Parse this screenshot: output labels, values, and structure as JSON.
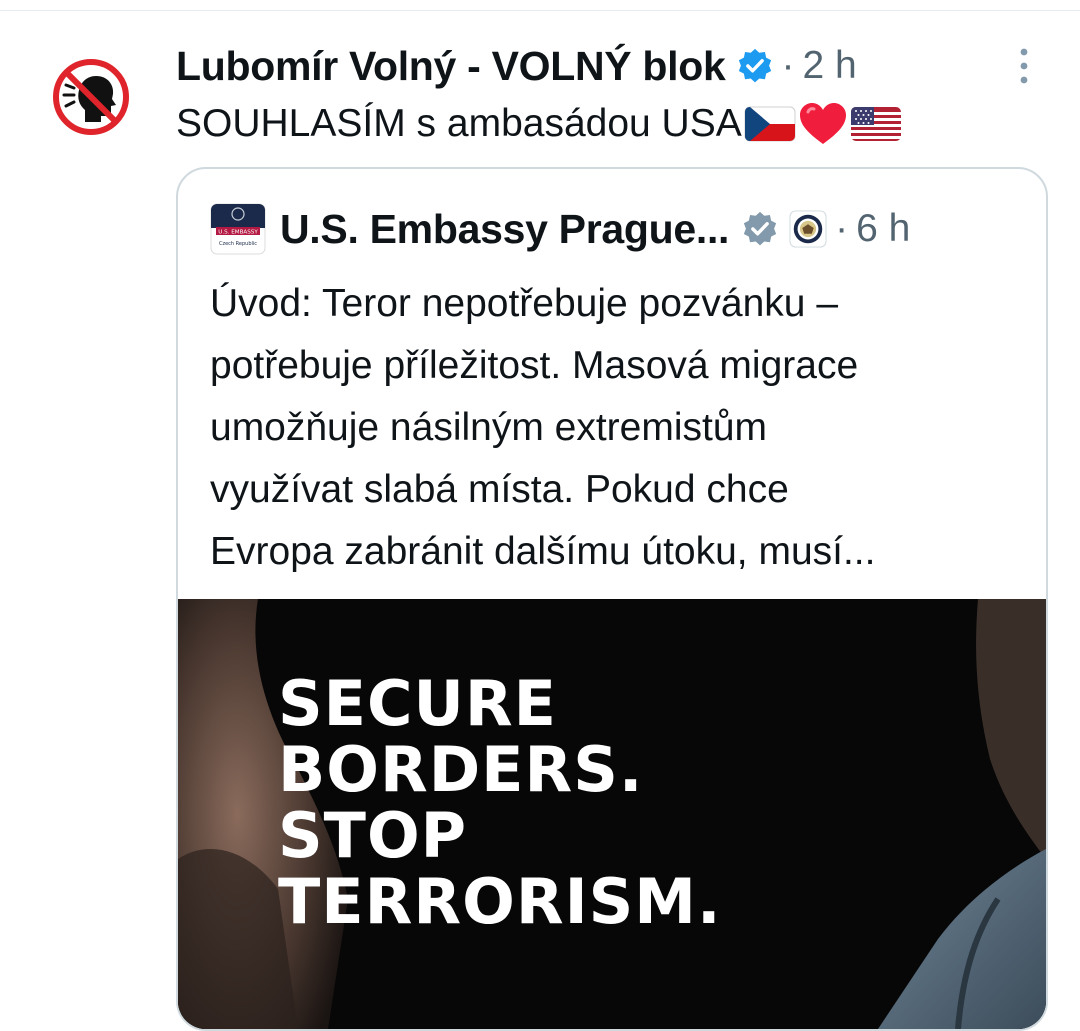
{
  "post": {
    "author_name": "Lubomír Volný - VOLNÝ blok",
    "timestamp": "2 h",
    "text": "SOUHLASÍM s ambasádou USA",
    "emoji": [
      "czech-flag",
      "red-heart",
      "us-flag"
    ],
    "avatar": "no-speaking-icon"
  },
  "quote": {
    "author_name": "U.S. Embassy Prague...",
    "timestamp": "6 h",
    "avatar_text": [
      "U.S. EMBASSY",
      "Czech Republic"
    ],
    "lines": [
      "Úvod: Teror nepotřebuje pozvánku –",
      "potřebuje příležitost. Masová migrace",
      "umožňuje násilným extremistům",
      "využívat slabá místa. Pokud chce",
      "Evropa zabránit dalšímu útoku, musí..."
    ],
    "image_headline": [
      "SECURE",
      "BORDERS.",
      "STOP",
      "TERRORISM."
    ]
  },
  "separator": "·",
  "colors": {
    "verified_blue": "#1d9bf0",
    "verified_gray": "#829aab",
    "text": "#0f1419",
    "muted": "#536471",
    "border": "#cfd9de",
    "no_sign_red": "#e0242b"
  }
}
